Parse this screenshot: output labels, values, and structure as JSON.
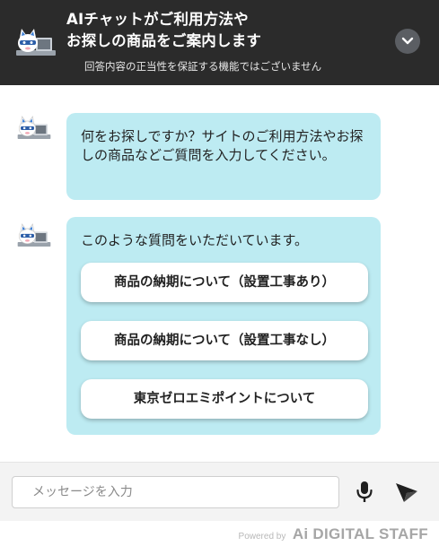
{
  "header": {
    "title_line1": "AIチャットがご利用方法や",
    "title_line2": "お探しの商品をご案内します",
    "disclaimer": "回答内容の正当性を保証する機能ではございません",
    "collapse_icon": "chevron-down-icon"
  },
  "messages": [
    {
      "sender": "bot",
      "text": "何をお探しですか？サイトのご利用方法やお探しの商品などご質問を入力してください。"
    },
    {
      "sender": "bot",
      "text": "このような質問をいただいています。",
      "quick_replies": [
        "商品の納期について（設置工事あり）",
        "商品の納期について（設置工事なし）",
        "東京ゼロエミポイントについて"
      ]
    }
  ],
  "composer": {
    "placeholder": "メッセージを入力",
    "value": "",
    "mic_icon": "microphone-icon",
    "send_icon": "send-icon"
  },
  "footer": {
    "powered_by": "Powered by",
    "brand": "Ai DIGITAL STAFF"
  },
  "colors": {
    "header_bg": "#2b2b2b",
    "bubble_bg": "#bdebf2",
    "composer_bg": "#f3f3f3"
  }
}
